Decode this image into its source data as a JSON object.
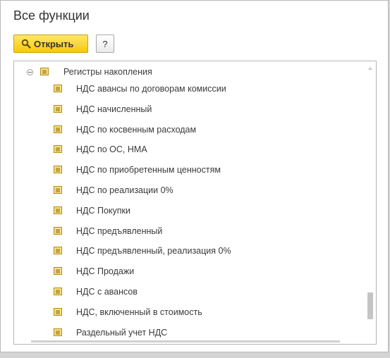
{
  "window": {
    "title": "Все функции"
  },
  "toolbar": {
    "open_label": "Открыть",
    "help_label": "?"
  },
  "tree": {
    "group": {
      "label": "Регистры накопления",
      "icon": "accumulation-register-icon",
      "expanded": true
    },
    "items": [
      {
        "label": "НДС авансы по договорам комиссии"
      },
      {
        "label": "НДС начисленный"
      },
      {
        "label": "НДС по косвенным расходам"
      },
      {
        "label": "НДС по ОС, НМА"
      },
      {
        "label": "НДС по приобретенным ценностям"
      },
      {
        "label": "НДС по реализации 0%"
      },
      {
        "label": "НДС Покупки"
      },
      {
        "label": "НДС предъявленный"
      },
      {
        "label": "НДС предъявленный, реализация 0%"
      },
      {
        "label": "НДС Продажи"
      },
      {
        "label": "НДС с авансов"
      },
      {
        "label": "НДС, включенный в стоимость"
      },
      {
        "label": "Раздельный учет НДС"
      }
    ]
  },
  "colors": {
    "open_button": "#f5c90b",
    "register_icon": "#e6b422",
    "border": "#b6b6b6"
  }
}
